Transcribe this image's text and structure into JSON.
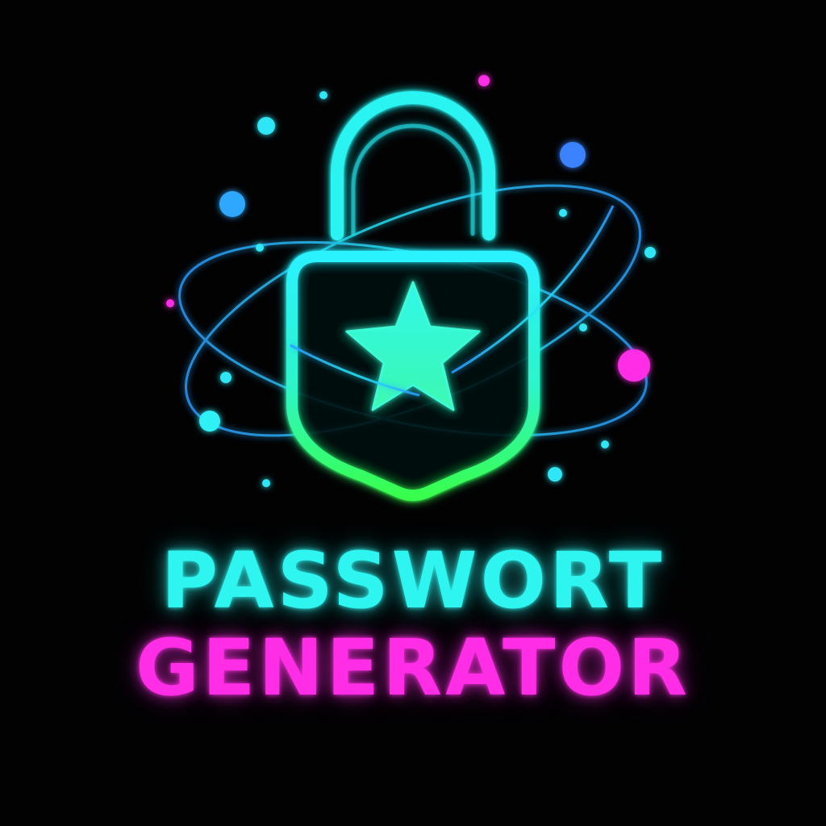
{
  "logo": {
    "icon": "padlock-star-icon",
    "orbit_icon": "orbit-rings-icon",
    "sparkle_icon": "sparkle-dots-icon"
  },
  "title": {
    "line1": "PASSWORT",
    "line2": "GENERATOR"
  },
  "colors": {
    "background": "#020203",
    "cyan": "#2ef5f0",
    "magenta": "#ff2ee6",
    "green": "#33ff66",
    "blue": "#3a8cff"
  }
}
